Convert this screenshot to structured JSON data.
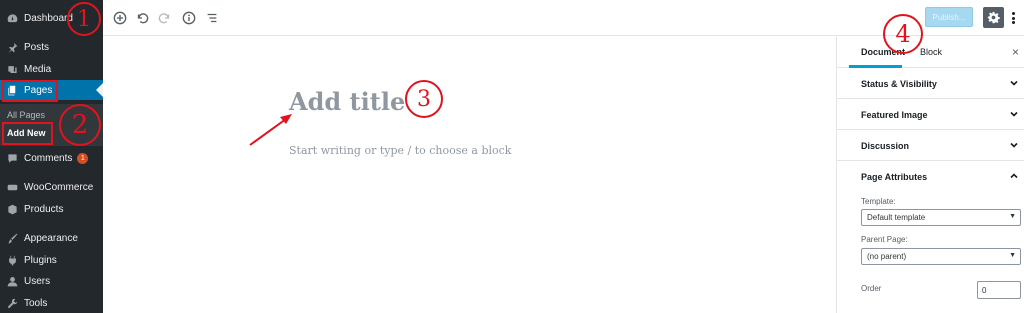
{
  "sidebar": {
    "items": [
      {
        "label": "Dashboard",
        "icon": "dashboard-icon"
      },
      {
        "label": "Posts",
        "icon": "pin-icon"
      },
      {
        "label": "Media",
        "icon": "media-icon"
      },
      {
        "label": "Pages",
        "icon": "pages-icon"
      },
      {
        "label": "Comments",
        "icon": "comment-icon",
        "badge": "1"
      },
      {
        "label": "WooCommerce",
        "icon": "woocommerce-icon"
      },
      {
        "label": "Products",
        "icon": "box-icon"
      },
      {
        "label": "Appearance",
        "icon": "brush-icon"
      },
      {
        "label": "Plugins",
        "icon": "plug-icon"
      },
      {
        "label": "Users",
        "icon": "user-icon"
      },
      {
        "label": "Tools",
        "icon": "wrench-icon"
      }
    ],
    "submenu": {
      "all_pages": "All Pages",
      "add_new": "Add New"
    }
  },
  "toolbar": {
    "publish_label": "Publish...",
    "icons": [
      "add-block-icon",
      "undo-icon",
      "redo-icon",
      "info-icon",
      "outline-icon",
      "gear-icon",
      "more-icon"
    ]
  },
  "editor": {
    "title_placeholder": "Add title",
    "block_placeholder": "Start writing or type / to choose a block"
  },
  "panel": {
    "tabs": {
      "document": "Document",
      "block": "Block"
    },
    "close": "×",
    "sections": {
      "status": "Status & Visibility",
      "featured": "Featured Image",
      "discussion": "Discussion",
      "attributes": "Page Attributes"
    },
    "template_label": "Template:",
    "template_value": "Default template",
    "parent_label": "Parent Page:",
    "parent_value": "(no parent)",
    "order_label": "Order",
    "order_value": "0"
  },
  "annotations": {
    "one": "1",
    "two": "2",
    "three": "3",
    "four": "4"
  },
  "colors": {
    "sidebar_bg": "#23282d",
    "accent": "#0073aa",
    "annotation": "#e0141e"
  }
}
